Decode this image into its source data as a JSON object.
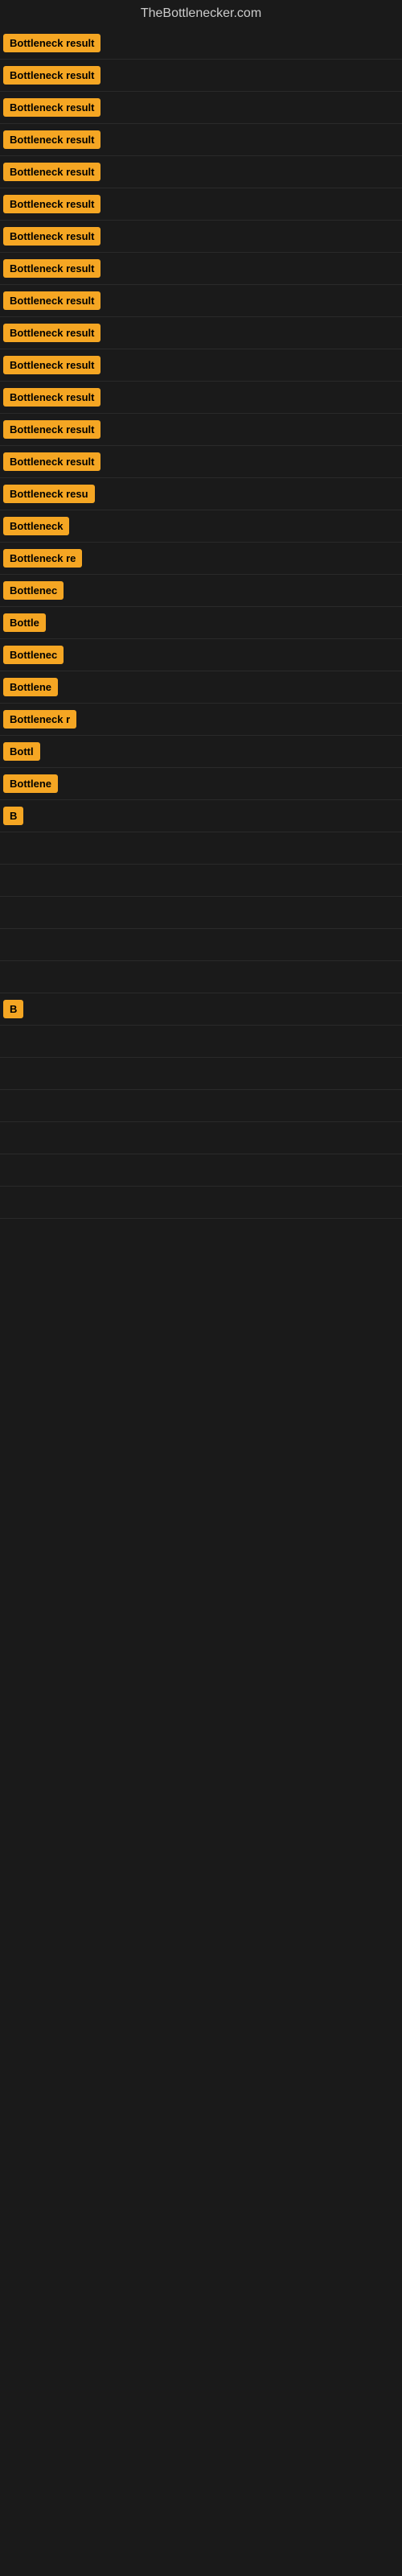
{
  "header": {
    "title": "TheBottlenecker.com"
  },
  "results": [
    {
      "label": "Bottleneck result",
      "visible": true,
      "truncated": false
    },
    {
      "label": "Bottleneck result",
      "visible": true,
      "truncated": false
    },
    {
      "label": "Bottleneck result",
      "visible": true,
      "truncated": false
    },
    {
      "label": "Bottleneck result",
      "visible": true,
      "truncated": false
    },
    {
      "label": "Bottleneck result",
      "visible": true,
      "truncated": false
    },
    {
      "label": "Bottleneck result",
      "visible": true,
      "truncated": false
    },
    {
      "label": "Bottleneck result",
      "visible": true,
      "truncated": false
    },
    {
      "label": "Bottleneck result",
      "visible": true,
      "truncated": false
    },
    {
      "label": "Bottleneck result",
      "visible": true,
      "truncated": false
    },
    {
      "label": "Bottleneck result",
      "visible": true,
      "truncated": false
    },
    {
      "label": "Bottleneck result",
      "visible": true,
      "truncated": false
    },
    {
      "label": "Bottleneck result",
      "visible": true,
      "truncated": false
    },
    {
      "label": "Bottleneck result",
      "visible": true,
      "truncated": false
    },
    {
      "label": "Bottleneck result",
      "visible": true,
      "truncated": false
    },
    {
      "label": "Bottleneck resu",
      "visible": true,
      "truncated": true
    },
    {
      "label": "Bottleneck",
      "visible": true,
      "truncated": true
    },
    {
      "label": "Bottleneck re",
      "visible": true,
      "truncated": true
    },
    {
      "label": "Bottlenec",
      "visible": true,
      "truncated": true
    },
    {
      "label": "Bottle",
      "visible": true,
      "truncated": true
    },
    {
      "label": "Bottlenec",
      "visible": true,
      "truncated": true
    },
    {
      "label": "Bottlene",
      "visible": true,
      "truncated": true
    },
    {
      "label": "Bottleneck r",
      "visible": true,
      "truncated": true
    },
    {
      "label": "Bottl",
      "visible": true,
      "truncated": true
    },
    {
      "label": "Bottlene",
      "visible": true,
      "truncated": true
    },
    {
      "label": "B",
      "visible": true,
      "truncated": true
    },
    {
      "label": "",
      "visible": false,
      "truncated": false
    },
    {
      "label": "",
      "visible": false,
      "truncated": false
    },
    {
      "label": "",
      "visible": false,
      "truncated": false
    },
    {
      "label": "",
      "visible": false,
      "truncated": false
    },
    {
      "label": "",
      "visible": false,
      "truncated": false
    },
    {
      "label": "B",
      "visible": true,
      "truncated": true
    },
    {
      "label": "",
      "visible": false,
      "truncated": false
    },
    {
      "label": "",
      "visible": false,
      "truncated": false
    },
    {
      "label": "",
      "visible": false,
      "truncated": false
    },
    {
      "label": "",
      "visible": false,
      "truncated": false
    },
    {
      "label": "",
      "visible": false,
      "truncated": false
    },
    {
      "label": "",
      "visible": false,
      "truncated": false
    }
  ],
  "badge_colors": {
    "background": "#f5a623",
    "text": "#000000"
  }
}
